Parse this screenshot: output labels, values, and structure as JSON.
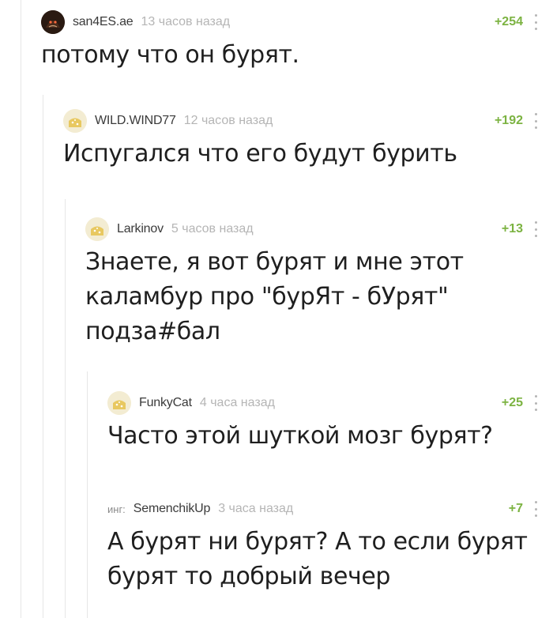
{
  "comments": [
    {
      "username": "san4ES.ae",
      "time": "13 часов назад",
      "rating": "+254",
      "avatar_icon": "dark-avatar-icon",
      "text": "потому что он бурят."
    },
    {
      "username": "WILD.WIND77",
      "time": "12 часов назад",
      "rating": "+192",
      "avatar_icon": "default-avatar-icon",
      "text": "Испугался что его будут бурить"
    },
    {
      "username": "Larkinov",
      "time": "5 часов назад",
      "rating": "+13",
      "avatar_icon": "default-avatar-icon",
      "text": "Знаете, я вот бурят и мне этот каламбур про \"бурЯт - бУрят\" подза#бал"
    },
    {
      "username": "FunkyCat",
      "time": "4 часа назад",
      "rating": "+25",
      "avatar_icon": "default-avatar-icon",
      "text": "Часто этой шуткой мозг бурят?"
    },
    {
      "avatar_text": "инг:",
      "username": "SemenchikUp",
      "time": "3 часа назад",
      "rating": "+7",
      "avatar_icon": "text-avatar",
      "text": "А бурят ни бурят? А то если бурят бурят то добрый вечер"
    }
  ],
  "colors": {
    "rating": "#7cb342",
    "username": "#3a3a3a",
    "time": "#b5b5b5",
    "text": "#1f1f1f",
    "guide": "#e6e6e6"
  }
}
